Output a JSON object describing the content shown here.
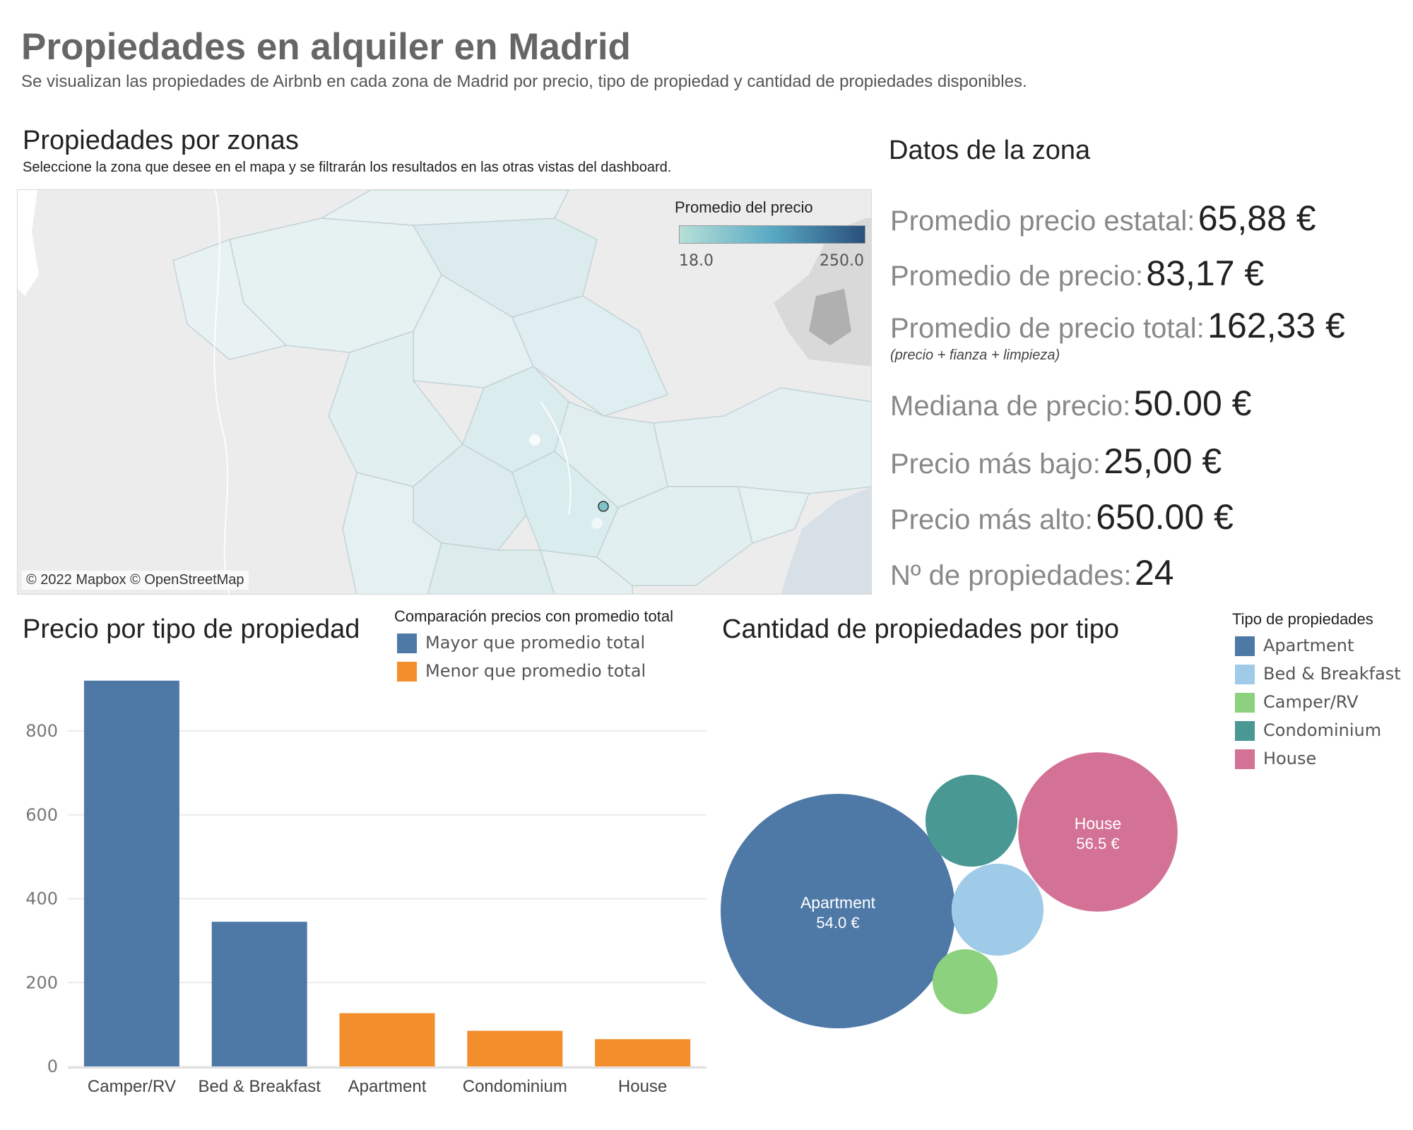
{
  "dashboard": {
    "title": "Propiedades en alquiler en Madrid",
    "subtitle": "Se visualizan las propiedades de Airbnb en cada zona de Madrid por precio, tipo de propiedad y cantidad de propiedades disponibles."
  },
  "map": {
    "title": "Propiedades por zonas",
    "subtitle": "Seleccione la zona que desee en el mapa y se filtrarán los resultados en las otras vistas del dashboard.",
    "legend_title": "Promedio del precio",
    "legend_min": "18.0",
    "legend_max": "250.0",
    "attribution": "© 2022 Mapbox © OpenStreetMap",
    "colors": {
      "low": "#b7e0d8",
      "mid": "#58a9c3",
      "high": "#2a4f7c"
    }
  },
  "zone": {
    "title": "Datos de la zona",
    "stats": [
      {
        "label": "Promedio precio estatal:",
        "value": "65,88 €"
      },
      {
        "label": "Promedio de precio:",
        "value": "83,17 €"
      },
      {
        "label": "Promedio de precio total:",
        "value": "162,33 €"
      },
      {
        "label": "Mediana de precio:",
        "value": "50.00 €"
      },
      {
        "label": "Precio más bajo:",
        "value": "25,00 €"
      },
      {
        "label": "Precio más alto:",
        "value": "650.00 €"
      },
      {
        "label": "Nº de propiedades:",
        "value": "24"
      }
    ],
    "note": "(precio + fianza + limpieza)"
  },
  "bar_panel": {
    "title": "Precio por tipo de propiedad",
    "legend_title": "Comparación precios con promedio total",
    "legend": [
      {
        "label": "Mayor que promedio total",
        "color": "#4e79a7"
      },
      {
        "label": "Menor que promedio total",
        "color": "#f28e2b"
      }
    ]
  },
  "bubble_panel": {
    "title": "Cantidad de propiedades por tipo",
    "legend_title": "Tipo de propiedades",
    "legend": [
      {
        "label": "Apartment",
        "color": "#4e79a7"
      },
      {
        "label": "Bed & Breakfast",
        "color": "#a0cbe8"
      },
      {
        "label": "Camper/RV",
        "color": "#8cd17d"
      },
      {
        "label": "Condominium",
        "color": "#499894"
      },
      {
        "label": "House",
        "color": "#d37295"
      }
    ]
  },
  "chart_data": [
    {
      "type": "bar",
      "title": "Precio por tipo de propiedad",
      "categories": [
        "Camper/RV",
        "Bed & Breakfast",
        "Apartment",
        "Condominium",
        "House"
      ],
      "values": [
        920,
        345,
        127,
        85,
        65
      ],
      "groups": [
        "Mayor que promedio total",
        "Mayor que promedio total",
        "Menor que promedio total",
        "Menor que promedio total",
        "Menor que promedio total"
      ],
      "y_ticks": [
        0,
        200,
        400,
        600,
        800
      ],
      "ylim": [
        0,
        960
      ],
      "grid": true
    },
    {
      "type": "bubble",
      "title": "Cantidad de propiedades por tipo",
      "series": [
        {
          "name": "Apartment",
          "count": 13,
          "label": "54.0 €",
          "show_label": true
        },
        {
          "name": "House",
          "count": 6,
          "label": "56.5 €",
          "show_label": true
        },
        {
          "name": "Condominium",
          "count": 2,
          "label": "",
          "show_label": false
        },
        {
          "name": "Bed & Breakfast",
          "count": 2,
          "label": "",
          "show_label": false
        },
        {
          "name": "Camper/RV",
          "count": 1,
          "label": "",
          "show_label": false
        }
      ]
    }
  ]
}
